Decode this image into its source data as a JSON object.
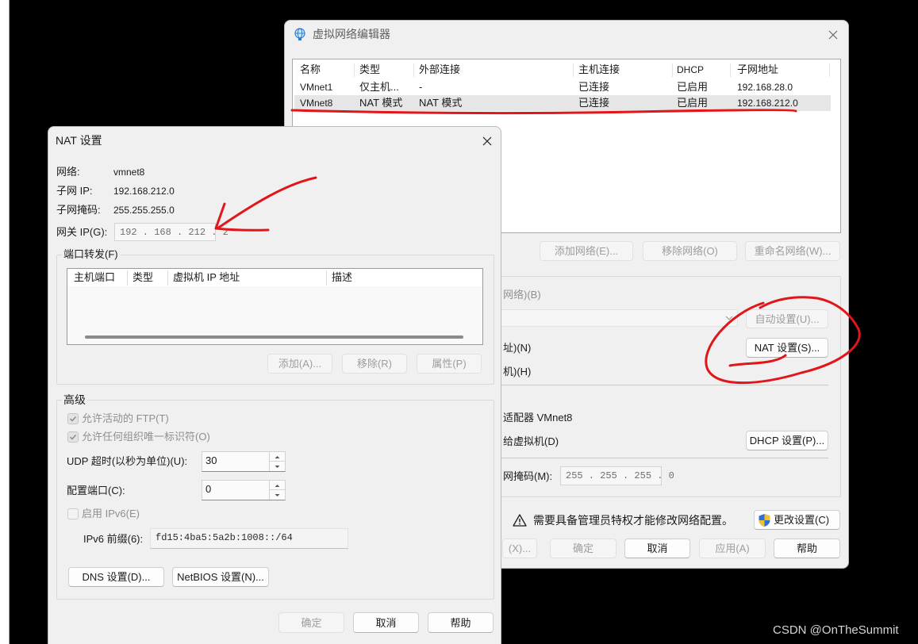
{
  "colors": {
    "background": "#000000",
    "dialog": "#f0f0f0",
    "selection": "#e6e6e6",
    "annotation": "#e0161b"
  },
  "editor": {
    "title": "虚拟网络编辑器",
    "network_table": {
      "headers": [
        "名称",
        "类型",
        "外部连接",
        "主机连接",
        "DHCP",
        "子网地址"
      ],
      "rows": [
        {
          "cells": [
            "VMnet1",
            "仅主机...",
            "-",
            "已连接",
            "已启用",
            "192.168.28.0"
          ],
          "selected": false
        },
        {
          "cells": [
            "VMnet8",
            "NAT 模式",
            "NAT 模式",
            "已连接",
            "已启用",
            "192.168.212.0"
          ],
          "selected": true
        }
      ]
    },
    "list_buttons": {
      "add": "添加网络(E)...",
      "remove": "移除网络(O)",
      "rename": "重命名网络(W)..."
    },
    "settings": {
      "bridged_label": "网络)(B)",
      "auto_button": "自动设置(U)...",
      "nat_label": "址)(N)",
      "nat_button": "NAT 设置(S)...",
      "host_only_label": "机)(H)",
      "adapter_label": "适配器 VMnet8",
      "dhcp_label": "给虚拟机(D)",
      "dhcp_button": "DHCP 设置(P)...",
      "mask_label": "网掩码(M):",
      "mask_value": "255 . 255 . 255 . 0"
    },
    "warning_text": "需要具备管理员特权才能修改网络配置。",
    "change_settings_button": "更改设置(C)",
    "footer": {
      "restore": "(X)...",
      "ok": "确定",
      "cancel": "取消",
      "apply": "应用(A)",
      "help": "帮助"
    }
  },
  "nat": {
    "title": "NAT 设置",
    "network_label": "网络:",
    "network_value": "vmnet8",
    "subnet_ip_label": "子网 IP:",
    "subnet_ip_value": "192.168.212.0",
    "subnet_mask_label": "子网掩码:",
    "subnet_mask_value": "255.255.255.0",
    "gateway_label": "网关 IP(G):",
    "gateway_value": "192 . 168 . 212 . 2",
    "port_forwarding": {
      "group_label": "端口转发(F)",
      "headers": [
        "主机端口",
        "类型",
        "虚拟机 IP 地址",
        "描述"
      ],
      "add_button": "添加(A)...",
      "remove_button": "移除(R)",
      "properties_button": "属性(P)"
    },
    "advanced": {
      "group_label": "高级",
      "active_ftp_label": "允许活动的 FTP(T)",
      "active_ftp_checked": true,
      "any_oui_label": "允许任何组织唯一标识符(O)",
      "any_oui_checked": true,
      "udp_timeout_label": "UDP 超时(以秒为单位)(U):",
      "udp_timeout_value": "30",
      "config_port_label": "配置端口(C):",
      "config_port_value": "0",
      "ipv6_label": "启用 IPv6(E)",
      "ipv6_checked": false,
      "ipv6_prefix_label": "IPv6 前缀(6):",
      "ipv6_prefix_value": "fd15:4ba5:5a2b:1008::/64",
      "dns_button": "DNS 设置(D)...",
      "netbios_button": "NetBIOS 设置(N)..."
    },
    "footer": {
      "ok": "确定",
      "cancel": "取消",
      "help": "帮助"
    }
  },
  "watermark": "CSDN @OnTheSummit"
}
